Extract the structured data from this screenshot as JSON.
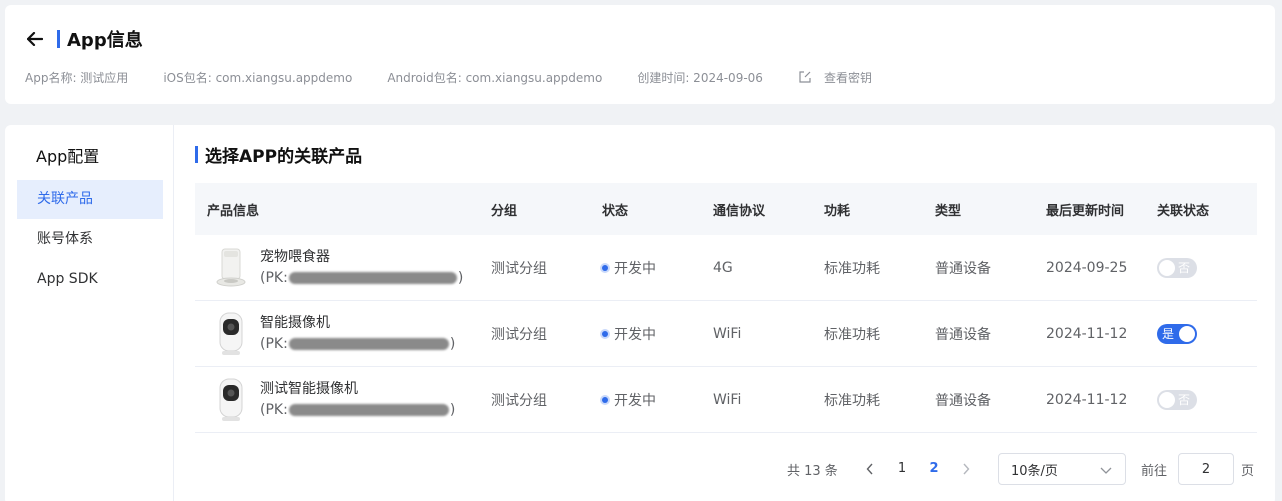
{
  "header": {
    "title": "App信息",
    "app_name": "App名称: 测试应用",
    "ios_package": "iOS包名: com.xiangsu.appdemo",
    "android_package": "Android包名: com.xiangsu.appdemo",
    "created": "创建时间: 2024-09-06",
    "view_key": "查看密钥"
  },
  "sidebar": {
    "title": "App配置",
    "items": [
      {
        "label": "关联产品",
        "active": true
      },
      {
        "label": "账号体系",
        "active": false
      },
      {
        "label": "App SDK",
        "active": false
      }
    ]
  },
  "section": {
    "title": "选择APP的关联产品"
  },
  "table": {
    "columns": [
      "产品信息",
      "分组",
      "状态",
      "通信协议",
      "功耗",
      "类型",
      "最后更新时间",
      "关联状态"
    ],
    "rows": [
      {
        "name": "宠物喂食器",
        "pk_prefix": "(PK: ",
        "pk_suffix": ")",
        "group": "测试分组",
        "status": "开发中",
        "protocol": "4G",
        "power": "标准功耗",
        "type": "普通设备",
        "updated": "2024-09-25",
        "linked": false,
        "switch_label": "否",
        "image": "pet-feeder"
      },
      {
        "name": "智能摄像机",
        "pk_prefix": "(PK: ",
        "pk_suffix": ")",
        "group": "测试分组",
        "status": "开发中",
        "protocol": "WiFi",
        "power": "标准功耗",
        "type": "普通设备",
        "updated": "2024-11-12",
        "linked": true,
        "switch_label": "是",
        "image": "camera"
      },
      {
        "name": "测试智能摄像机",
        "pk_prefix": "(PK: ",
        "pk_suffix": ")",
        "group": "测试分组",
        "status": "开发中",
        "protocol": "WiFi",
        "power": "标准功耗",
        "type": "普通设备",
        "updated": "2024-11-12",
        "linked": false,
        "switch_label": "否",
        "image": "camera"
      }
    ]
  },
  "pagination": {
    "total": "共 13 条",
    "pages": [
      "1",
      "2"
    ],
    "current": "2",
    "page_size": "10条/页",
    "goto_label": "前往",
    "goto_value": "2",
    "page_label": "页"
  },
  "colors": {
    "accent": "#2f6bea",
    "switch_off": "#dcdfe6"
  },
  "icons": [
    "arrow-left-icon",
    "edit-icon",
    "chevron-left-icon",
    "chevron-right-icon",
    "chevron-down-icon"
  ]
}
